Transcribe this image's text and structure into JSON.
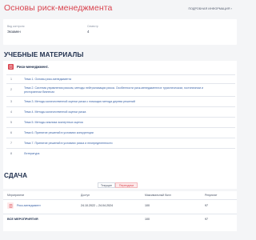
{
  "page": {
    "title": "Основы риск-менеджмента",
    "details_link": "ПОДРОБНАЯ ИНФОРМАЦИЯ"
  },
  "info": {
    "control_label": "Вид контроля",
    "control_value": "Экзамен",
    "semester_label": "Семестр",
    "semester_value": "4"
  },
  "materials": {
    "section_title": "УЧЕБНЫЕ МАТЕРИАЛЫ",
    "header_label": "Риск-менеджмент.",
    "items": [
      {
        "num": "1",
        "text": "Тема 1. Основы риск-менеджмента"
      },
      {
        "num": "2",
        "text": "Тема 2. Система управления риском, методы нейтрализации риска. Особенности риск-менеджмента в туристическом, гостиничном и ресторанном бизнесах"
      },
      {
        "num": "3",
        "text": "Тема 3. Методы количественной оценки риска с помощью метода дерева решений"
      },
      {
        "num": "4",
        "text": "Тема 4. Методы количественной оценки риска"
      },
      {
        "num": "5",
        "text": "Тема 5. Методы анализа экспертных оценок"
      },
      {
        "num": "6",
        "text": "Тема 6. Принятие решений в условиях конкуренции"
      },
      {
        "num": "7",
        "text": "Тема 7. Принятие решений в условиях риска и неопределенности"
      },
      {
        "num": "8",
        "text": "Литература"
      }
    ]
  },
  "sdacha": {
    "section_title": "СДАЧА",
    "tabs": [
      {
        "label": "Текущие",
        "active": false
      },
      {
        "label": "Пересдачи",
        "active": true
      }
    ],
    "columns": {
      "event": "Мероприятие",
      "access": "Доступ",
      "max_score": "Максимальный балл",
      "result": "Результат"
    },
    "rows": [
      {
        "event": "Риск-менеджмент",
        "access": "24.10.2022 – 24.04.2024",
        "max_score": "100",
        "result": "97"
      }
    ],
    "total": {
      "label": "ВСЕ МЕРОПРИЯТИЯ",
      "max_score": "100",
      "result": "97"
    }
  },
  "colors": {
    "accent": "#d9434e",
    "heading": "#1f2f4d",
    "link": "#3b64a8",
    "background": "#f4f5f7"
  },
  "icons": {
    "material": "book-icon",
    "event": "document-icon",
    "details": "chevron-right-icon"
  }
}
